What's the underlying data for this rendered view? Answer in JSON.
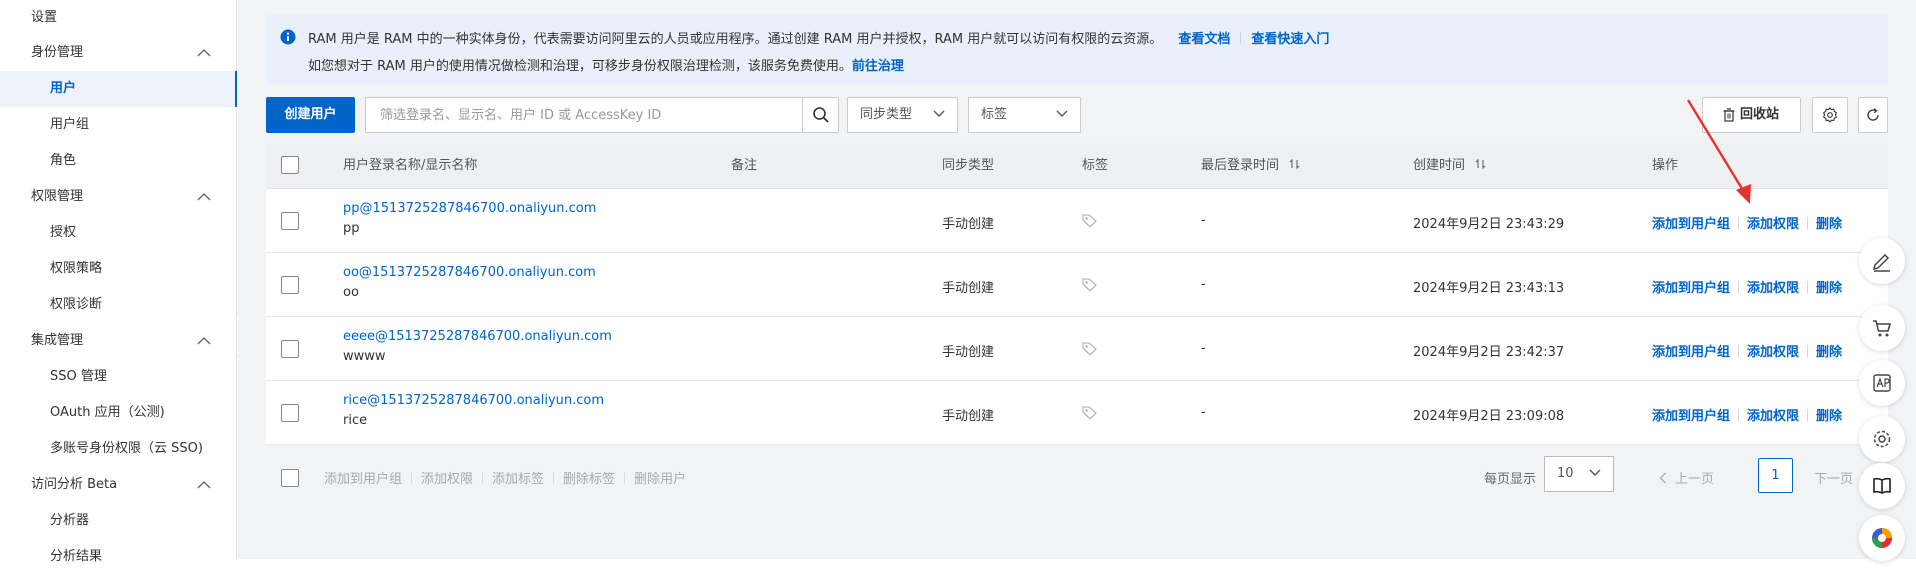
{
  "sidebar": {
    "items": [
      {
        "label": "设置",
        "type": "group"
      },
      {
        "label": "身份管理",
        "type": "group",
        "expanded": true
      },
      {
        "label": "用户",
        "type": "sub",
        "active": true
      },
      {
        "label": "用户组",
        "type": "sub"
      },
      {
        "label": "角色",
        "type": "sub"
      },
      {
        "label": "权限管理",
        "type": "group",
        "expanded": true
      },
      {
        "label": "授权",
        "type": "sub"
      },
      {
        "label": "权限策略",
        "type": "sub"
      },
      {
        "label": "权限诊断",
        "type": "sub"
      },
      {
        "label": "集成管理",
        "type": "group",
        "expanded": true
      },
      {
        "label": "SSO 管理",
        "type": "sub"
      },
      {
        "label": "OAuth 应用（公测)",
        "type": "sub"
      },
      {
        "label": "多账号身份权限（云 SSO)",
        "type": "sub"
      },
      {
        "label": "访问分析 Beta",
        "type": "group",
        "expanded": true
      },
      {
        "label": "分析器",
        "type": "sub"
      },
      {
        "label": "分析结果",
        "type": "sub"
      }
    ]
  },
  "notice": {
    "line1_text": "RAM 用户是 RAM 中的一种实体身份，代表需要访问阿里云的人员或应用程序。通过创建 RAM 用户并授权，RAM 用户就可以访问有权限的云资源。",
    "link_docs": "查看文档",
    "link_quickstart": "查看快速入门",
    "line2_text": "如您想对于 RAM 用户的使用情况做检测和治理，可移步身份权限治理检测，该服务免费使用。",
    "link_govern": "前往治理"
  },
  "toolbar": {
    "create_label": "创建用户",
    "search_placeholder": "筛选登录名、显示名、用户 ID 或 AccessKey ID",
    "sync_type_label": "同步类型",
    "tag_label": "标签",
    "recycle_label": "回收站"
  },
  "table": {
    "headers": {
      "name": "用户登录名称/显示名称",
      "remark": "备注",
      "sync": "同步类型",
      "tag": "标签",
      "last_login": "最后登录时间",
      "created": "创建时间",
      "actions": "操作"
    },
    "rows": [
      {
        "login": "pp@1513725287846700.onaliyun.com",
        "display": "pp",
        "sync": "手动创建",
        "last_login": "-",
        "created": "2024年9月2日 23:43:29"
      },
      {
        "login": "oo@1513725287846700.onaliyun.com",
        "display": "oo",
        "sync": "手动创建",
        "last_login": "-",
        "created": "2024年9月2日 23:43:13"
      },
      {
        "login": "eeee@1513725287846700.onaliyun.com",
        "display": "wwww",
        "sync": "手动创建",
        "last_login": "-",
        "created": "2024年9月2日 23:42:37"
      },
      {
        "login": "rice@1513725287846700.onaliyun.com",
        "display": "rice",
        "sync": "手动创建",
        "last_login": "-",
        "created": "2024年9月2日 23:09:08"
      }
    ],
    "actions": {
      "add_group": "添加到用户组",
      "add_perm": "添加权限",
      "delete": "删除"
    }
  },
  "footer": {
    "batch": [
      "添加到用户组",
      "添加权限",
      "添加标签",
      "删除标签",
      "删除用户"
    ],
    "page_size_label": "每页显示",
    "page_size": "10",
    "prev": "上一页",
    "current_page": "1",
    "next": "下一页"
  },
  "colors": {
    "primary": "#0064c8",
    "notice_bg": "#e9f0fb",
    "annotation_arrow": "#e8322e"
  }
}
